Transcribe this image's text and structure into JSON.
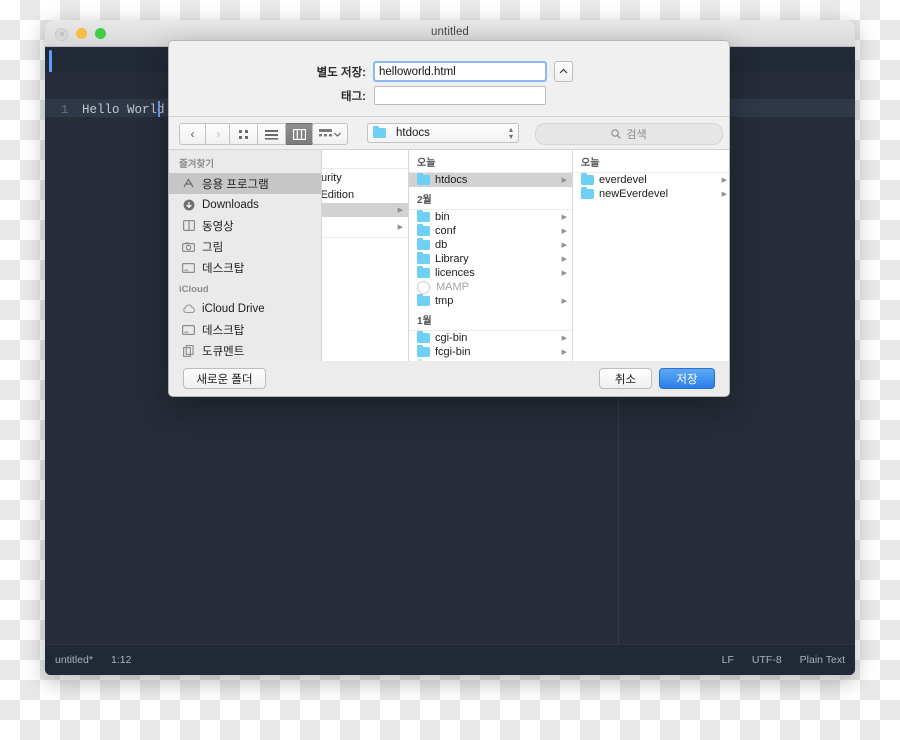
{
  "editor": {
    "window_title": "untitled",
    "tab_label": "untitled",
    "line_number": "1",
    "code_text": "Hello World",
    "status": {
      "file": "untitled*",
      "position": "1:12",
      "line_ending": "LF",
      "encoding": "UTF-8",
      "syntax": "Plain Text"
    }
  },
  "dialog": {
    "save_as_label": "별도 저장:",
    "filename_value": "helloworld.html",
    "tags_label": "태그:",
    "tags_value": "",
    "expand_icon": "chevron-up-icon",
    "toolbar": {
      "back_icon": "chevron-left-icon",
      "forward_icon": "chevron-right-icon",
      "icon_view_icon": "grid-view-icon",
      "list_view_icon": "list-view-icon",
      "column_view_icon": "column-view-icon",
      "group_icon": "group-by-icon",
      "group_caret_icon": "chevron-down-icon",
      "location_name": "htdocs",
      "location_icon": "folder-icon",
      "stepper_icon": "updown-stepper-icon",
      "search_icon": "search-icon",
      "search_placeholder": "검색"
    },
    "sidebar": {
      "sections": [
        {
          "header": "즐겨찾기",
          "items": [
            {
              "label": "응용 프로그램",
              "icon": "applications-icon",
              "selected": true
            },
            {
              "label": "Downloads",
              "icon": "downloads-icon",
              "selected": false
            },
            {
              "label": "동영상",
              "icon": "movies-icon",
              "selected": false
            },
            {
              "label": "그림",
              "icon": "pictures-icon",
              "selected": false
            },
            {
              "label": "데스크탑",
              "icon": "desktop-icon",
              "selected": false
            }
          ]
        },
        {
          "header": "iCloud",
          "items": [
            {
              "label": "iCloud Drive",
              "icon": "icloud-icon",
              "selected": false
            },
            {
              "label": "데스크탑",
              "icon": "desktop-icon",
              "selected": false
            },
            {
              "label": "도큐멘트",
              "icon": "documents-icon",
              "selected": false
            }
          ]
        }
      ]
    },
    "columns": {
      "col1": {
        "rows": [
          {
            "label": "",
            "type": "blank"
          },
          {
            "label": "Security",
            "type": "text",
            "clipped": true
          },
          {
            "label": "loperEdition",
            "type": "text",
            "clipped": true
          },
          {
            "label": "",
            "type": "selected"
          },
          {
            "label": "",
            "type": "arrow"
          }
        ]
      },
      "col2": {
        "groups": [
          {
            "header": "오늘",
            "items": [
              {
                "label": "htdocs",
                "icon": "folder-icon",
                "selected": true,
                "disclosure": true
              }
            ]
          },
          {
            "header": "2월",
            "items": [
              {
                "label": "bin",
                "icon": "folder-icon",
                "selected": false,
                "disclosure": true
              },
              {
                "label": "conf",
                "icon": "folder-icon",
                "selected": false,
                "disclosure": true
              },
              {
                "label": "db",
                "icon": "folder-icon",
                "selected": false,
                "disclosure": true
              },
              {
                "label": "Library",
                "icon": "folder-icon",
                "selected": false,
                "disclosure": true
              },
              {
                "label": "licences",
                "icon": "folder-icon",
                "selected": false,
                "disclosure": true
              },
              {
                "label": "MAMP",
                "icon": "app-icon",
                "selected": false,
                "disclosure": false,
                "dim": true
              },
              {
                "label": "tmp",
                "icon": "folder-icon",
                "selected": false,
                "disclosure": true
              }
            ]
          },
          {
            "header": "1월",
            "items": [
              {
                "label": "cgi-bin",
                "icon": "folder-icon",
                "selected": false,
                "disclosure": true
              },
              {
                "label": "fcgi-bin",
                "icon": "folder-icon",
                "selected": false,
                "disclosure": true
              }
            ]
          }
        ]
      },
      "col3": {
        "groups": [
          {
            "header": "오늘",
            "items": [
              {
                "label": "everdevel",
                "icon": "folder-icon",
                "selected": false,
                "disclosure": true
              },
              {
                "label": "newEverdevel",
                "icon": "folder-icon",
                "selected": false,
                "disclosure": true
              }
            ]
          }
        ]
      }
    },
    "footer": {
      "new_folder_label": "새로운 폴더",
      "cancel_label": "취소",
      "save_label": "저장"
    }
  },
  "colors": {
    "accent_blue": "#2a7fe8",
    "folder_blue": "#6fd0f5",
    "editor_bg": "#262c38",
    "focus_ring": "#8ab9ef"
  }
}
